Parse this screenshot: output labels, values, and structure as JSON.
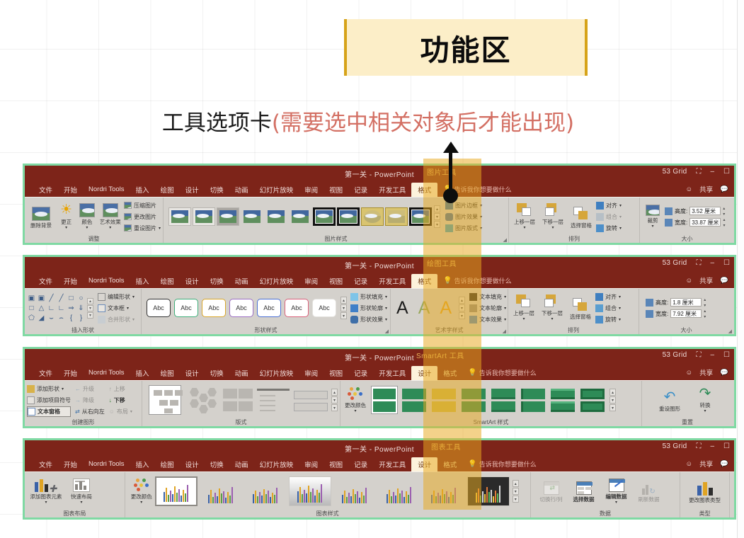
{
  "slide": {
    "title": "功能区",
    "subtitle_main": "工具选项卡",
    "subtitle_paren": "(需要选中相关对象后才能出现)",
    "accent_gold": "#d6a319",
    "banner_bg": "#fceec8",
    "paren_color": "#d36f63",
    "highlight_color": "#e8a81e",
    "ribbon_border_color": "#7fd9a3",
    "ribbon_titlebar_color": "#7d2419"
  },
  "common": {
    "doc_title": "第一关  -  PowerPoint",
    "grid_name": "53 Grid",
    "tell_me": "告诉我你想要做什么",
    "share": "共享",
    "tabs": [
      "文件",
      "开始",
      "Nordri Tools",
      "插入",
      "绘图",
      "设计",
      "切换",
      "动画",
      "幻灯片放映",
      "审阅",
      "视图",
      "记录",
      "开发工具"
    ]
  },
  "ribbons": [
    {
      "id": "picture-tools",
      "context_title": "图片工具",
      "context_tabs": [
        {
          "label": "格式",
          "active": true
        }
      ],
      "groups": [
        {
          "name": "调整",
          "buttons": [
            {
              "label": "删除背景",
              "icon": "picture-icon"
            },
            {
              "label": "更正",
              "icon": "brightness-icon"
            },
            {
              "label": "颜色",
              "icon": "color-picture-icon"
            },
            {
              "label": "艺术效果",
              "icon": "artistic-effects-icon"
            }
          ],
          "small_items": [
            "压缩图片",
            "更改图片",
            "重设图片"
          ]
        },
        {
          "name": "图片样式",
          "gallery": [
            "style-1",
            "style-2",
            "style-3",
            "style-4",
            "style-5",
            "style-6",
            "style-7",
            "style-8",
            "style-9",
            "style-10",
            "style-11"
          ],
          "small_items": [
            "图片边框",
            "图片效果",
            "图片版式"
          ]
        },
        {
          "name": "排列",
          "buttons": [
            {
              "label": "上移一层",
              "icon": "bring-forward-icon"
            },
            {
              "label": "下移一层",
              "icon": "send-backward-icon"
            },
            {
              "label": "选择窗格",
              "icon": "selection-pane-icon"
            }
          ],
          "small_items": [
            "对齐",
            "组合",
            "旋转"
          ]
        },
        {
          "name": "大小",
          "buttons": [
            {
              "label": "裁剪",
              "icon": "crop-icon"
            }
          ],
          "fields": [
            {
              "label": "高度:",
              "value": "3.52 厘米"
            },
            {
              "label": "宽度:",
              "value": "33.87 厘米"
            }
          ]
        }
      ]
    },
    {
      "id": "drawing-tools",
      "context_title": "绘图工具",
      "context_tabs": [
        {
          "label": "格式",
          "active": true
        }
      ],
      "groups": [
        {
          "name": "插入形状",
          "small_items": [
            "编辑形状",
            "文本框",
            "合并形状"
          ]
        },
        {
          "name": "形状样式",
          "gallery_label": "Abc",
          "gallery_colors": [
            "#333333",
            "#3fae7a",
            "#d9a62a",
            "#9b6fc4",
            "#4a6fd4",
            "#d9607a",
            "#cccccc"
          ],
          "small_items": [
            "形状填充",
            "形状轮廓",
            "形状效果"
          ]
        },
        {
          "name": "艺术字样式",
          "gallery_letters": [
            "A",
            "A",
            "A"
          ],
          "small_items": [
            "文本填充",
            "文本轮廓",
            "文本效果"
          ]
        },
        {
          "name": "排列",
          "buttons": [
            {
              "label": "上移一层",
              "icon": "bring-forward-icon"
            },
            {
              "label": "下移一层",
              "icon": "send-backward-icon"
            },
            {
              "label": "选择窗格",
              "icon": "selection-pane-icon"
            }
          ],
          "small_items": [
            "对齐",
            "组合",
            "旋转"
          ]
        },
        {
          "name": "大小",
          "fields": [
            {
              "label": "高度:",
              "value": "1.8 厘米"
            },
            {
              "label": "宽度:",
              "value": "7.92 厘米"
            }
          ]
        }
      ]
    },
    {
      "id": "smartart-tools",
      "context_title": "SmartArt 工具",
      "context_tabs": [
        {
          "label": "设计",
          "active": true
        },
        {
          "label": "格式",
          "active": false
        }
      ],
      "groups": [
        {
          "name": "创建图形",
          "small_items": [
            "添加形状",
            "添加项目符号",
            "文本窗格",
            "升级",
            "降级",
            "从右向左",
            "上移",
            "下移",
            "布局"
          ]
        },
        {
          "name": "版式",
          "gallery": [
            "layout-1",
            "layout-2",
            "layout-3",
            "layout-4",
            "layout-5"
          ]
        },
        {
          "name": "SmartArt 样式",
          "buttons": [
            {
              "label": "更改颜色",
              "icon": "change-colors-icon"
            }
          ],
          "gallery": [
            "sa-1",
            "sa-2",
            "sa-3",
            "sa-4",
            "sa-5",
            "sa-6",
            "sa-7",
            "sa-8"
          ]
        },
        {
          "name": "重置",
          "buttons": [
            {
              "label": "重设图形",
              "icon": "reset-graphic-icon"
            },
            {
              "label": "转换",
              "icon": "convert-icon"
            }
          ]
        }
      ]
    },
    {
      "id": "chart-tools",
      "context_title": "图表工具",
      "context_tabs": [
        {
          "label": "设计",
          "active": true
        },
        {
          "label": "格式",
          "active": false
        }
      ],
      "groups": [
        {
          "name": "图表布局",
          "buttons": [
            {
              "label": "添加图表元素",
              "icon": "add-chart-element-icon"
            },
            {
              "label": "快速布局",
              "icon": "quick-layout-icon"
            }
          ]
        },
        {
          "name": "图表样式",
          "buttons": [
            {
              "label": "更改颜色",
              "icon": "change-colors-icon"
            }
          ],
          "gallery": [
            "ch-1",
            "ch-2",
            "ch-3",
            "ch-4",
            "ch-5",
            "ch-6",
            "ch-7",
            "ch-8",
            "ch-9"
          ]
        },
        {
          "name": "数据",
          "buttons": [
            {
              "label": "切换行/列",
              "icon": "switch-row-column-icon",
              "disabled": true
            },
            {
              "label": "选择数据",
              "icon": "select-data-icon"
            },
            {
              "label": "编辑数据",
              "icon": "edit-data-icon"
            },
            {
              "label": "刷新数据",
              "icon": "refresh-data-icon",
              "disabled": true
            }
          ]
        },
        {
          "name": "类型",
          "buttons": [
            {
              "label": "更改图表类型",
              "icon": "change-chart-type-icon"
            }
          ]
        }
      ]
    }
  ]
}
